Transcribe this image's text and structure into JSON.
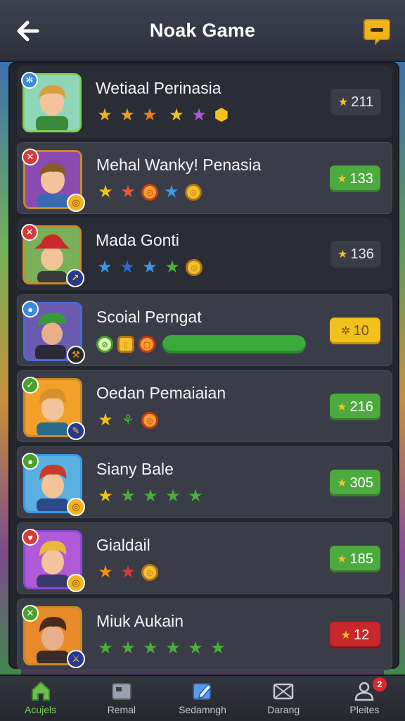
{
  "header": {
    "title": "Noak Game",
    "back_icon": "arrow-left-icon",
    "chat_icon": "chat-bubble-icon"
  },
  "rows": [
    {
      "name": "Wetiaal Perinasia",
      "score": "211",
      "score_style": "dark",
      "badge_color": "#3a8ad8"
    },
    {
      "name": "Mehal Wanky! Penasia",
      "score": "133",
      "score_style": "green",
      "badge_color": "#d83a3a"
    },
    {
      "name": "Mada Gonti",
      "score": "136",
      "score_style": "dark",
      "badge_color": "#d83a3a"
    },
    {
      "name": "Scoial Perngat",
      "score": "10",
      "score_style": "gold",
      "badge_color": "#3a8ad8"
    },
    {
      "name": "Oedan Pemaiaian",
      "score": "216",
      "score_style": "green",
      "badge_color": "#4aa02a"
    },
    {
      "name": "Siany Bale",
      "score": "305",
      "score_style": "green",
      "badge_color": "#4aa02a"
    },
    {
      "name": "Gialdail",
      "score": "185",
      "score_style": "green",
      "badge_color": "#d83a3a"
    },
    {
      "name": "Miuk Aukain",
      "score": "12",
      "score_style": "red",
      "badge_color": "#4aa02a"
    }
  ],
  "nav": [
    {
      "label": "Acujels",
      "icon": "home-icon",
      "active": true
    },
    {
      "label": "Remal",
      "icon": "inbox-icon",
      "active": false
    },
    {
      "label": "Sedamngh",
      "icon": "edit-icon",
      "active": false
    },
    {
      "label": "Darang",
      "icon": "mail-icon",
      "active": false
    },
    {
      "label": "Pleites",
      "icon": "profile-icon",
      "active": false,
      "badge": "2"
    }
  ],
  "colors": {
    "accent_green": "#4caa3e",
    "accent_gold": "#f2c21c",
    "accent_red": "#c8282c",
    "panel": "#23252d"
  }
}
